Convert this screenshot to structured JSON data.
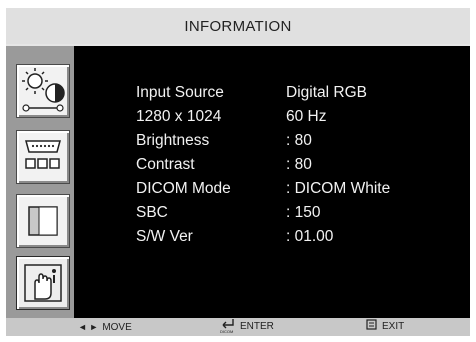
{
  "osd": {
    "title": "INFORMATION",
    "sidebar": {
      "items": [
        {
          "icon": "brightness-contrast-icon"
        },
        {
          "icon": "input-connector-icon"
        },
        {
          "icon": "picture-icon"
        },
        {
          "icon": "hand-info-icon"
        }
      ]
    },
    "info": {
      "rows": [
        {
          "label": "Input Source",
          "value": "Digital RGB"
        },
        {
          "label": "1280 x 1024",
          "value": "60 Hz"
        },
        {
          "label": "Brightness",
          "value": ": 80"
        },
        {
          "label": "Contrast",
          "value": ": 80"
        },
        {
          "label": "DICOM Mode",
          "value": ": DICOM White"
        },
        {
          "label": "SBC",
          "value": ": 150"
        },
        {
          "label": "S/W  Ver",
          "value": ": 01.00"
        }
      ]
    },
    "footer": {
      "move": {
        "glyph": "◄ ►",
        "label": "MOVE"
      },
      "enter": {
        "sub": "DICOM",
        "label": "ENTER"
      },
      "exit": {
        "label": "EXIT"
      }
    }
  }
}
